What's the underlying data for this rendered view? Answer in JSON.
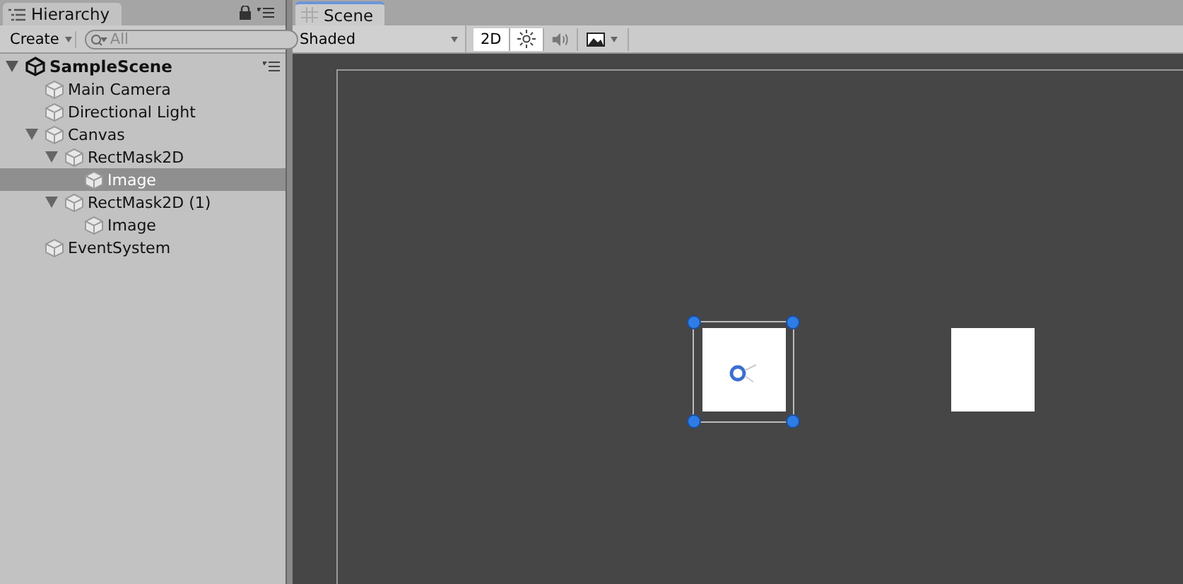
{
  "hierarchy": {
    "tab": {
      "label": "Hierarchy",
      "selected": true
    },
    "create_button": "Create",
    "search": {
      "placeholder": "All"
    },
    "scene": {
      "name": "SampleScene",
      "expanded": true,
      "children": [
        {
          "name": "Main Camera",
          "selected": false
        },
        {
          "name": "Directional Light",
          "selected": false
        },
        {
          "name": "Canvas",
          "expanded": true,
          "selected": false,
          "children": [
            {
              "name": "RectMask2D",
              "expanded": true,
              "selected": false,
              "children": [
                {
                  "name": "Image",
                  "selected": true
                }
              ]
            },
            {
              "name": "RectMask2D (1)",
              "expanded": true,
              "selected": false,
              "children": [
                {
                  "name": "Image",
                  "selected": false
                }
              ]
            }
          ]
        },
        {
          "name": "EventSystem",
          "selected": false
        }
      ]
    }
  },
  "scene_view": {
    "tab": {
      "label": "Scene",
      "selected": true
    },
    "shading": "Shaded",
    "mode_2d": {
      "label": "2D",
      "on": true
    },
    "lighting_on": true,
    "audio_on": false
  }
}
